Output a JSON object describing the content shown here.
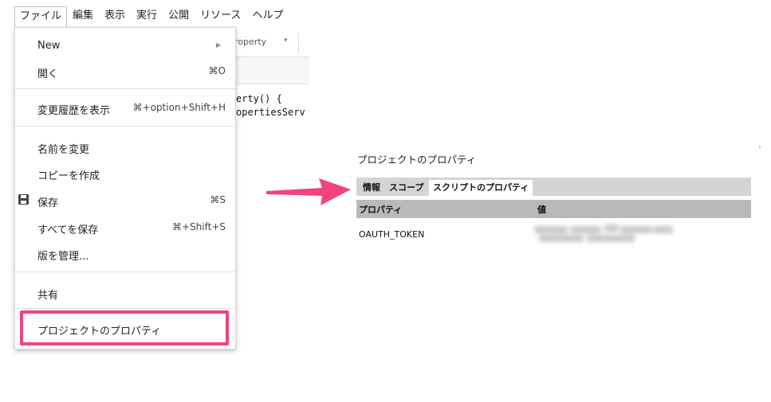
{
  "menubar": {
    "items": [
      "ファイル",
      "編集",
      "表示",
      "実行",
      "公開",
      "リソース",
      "ヘルプ"
    ]
  },
  "editor": {
    "function_select": "roperty",
    "code_lines": [
      "erty() {",
      "opertiesServ"
    ]
  },
  "file_menu": {
    "new_label": "New",
    "open_label": "開く",
    "open_shortcut": "⌘O",
    "history_label": "変更履歴を表示",
    "history_shortcut": "⌘+option+Shift+H",
    "rename_label": "名前を変更",
    "copy_label": "コピーを作成",
    "save_label": "保存",
    "save_shortcut": "⌘S",
    "save_all_label": "すべてを保存",
    "save_all_shortcut": "⌘+Shift+S",
    "versions_label": "版を管理...",
    "share_label": "共有",
    "project_props_label": "プロジェクトのプロパティ"
  },
  "dialog": {
    "title": "プロジェクトのプロパティ",
    "tabs": [
      "情報",
      "スコープ",
      "スクリプトのプロパティ"
    ],
    "active_tab_index": 2,
    "columns": [
      "プロパティ",
      "値"
    ],
    "rows": [
      {
        "key": "OAUTH_TOKEN"
      }
    ]
  },
  "colors": {
    "highlight": "#f2437a",
    "arrow": "#f2437a"
  }
}
